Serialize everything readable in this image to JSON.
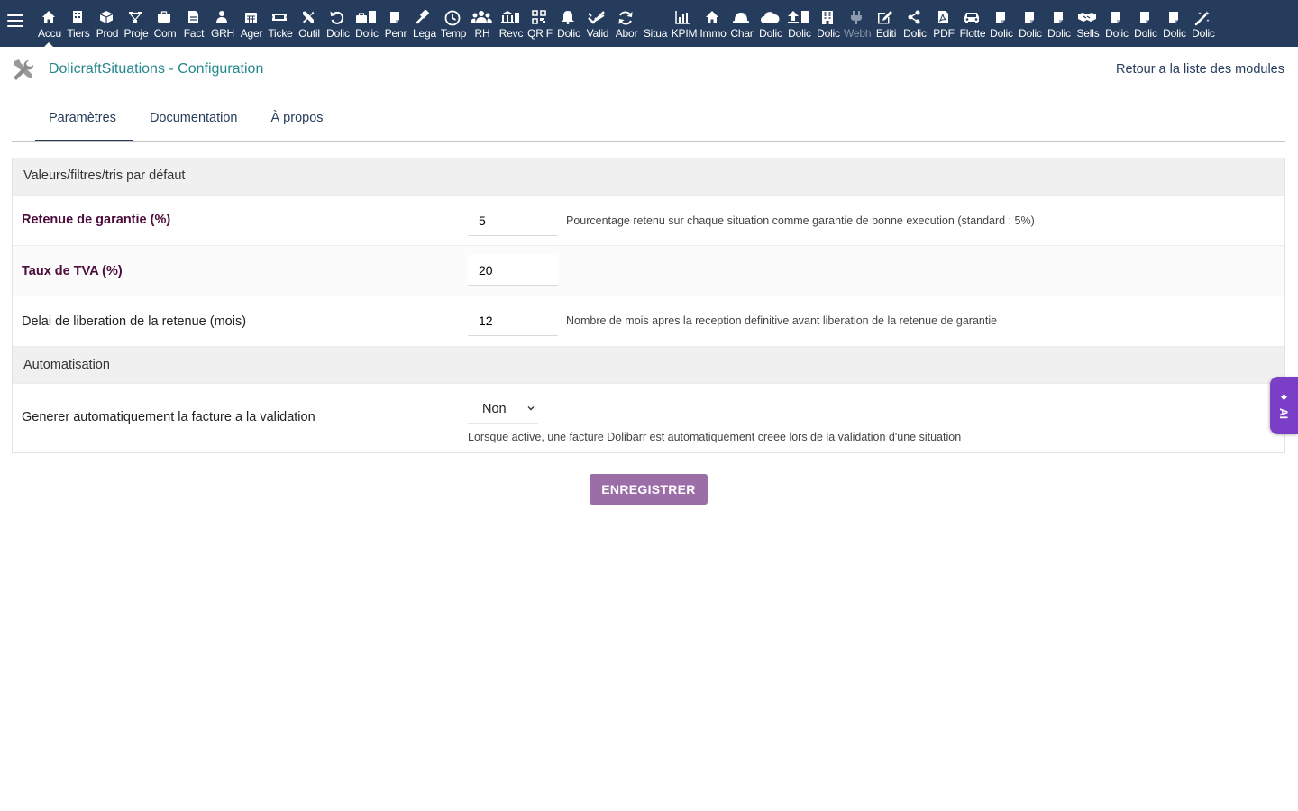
{
  "topbar": {
    "items": [
      {
        "label": "Accu",
        "icon": "home-icon",
        "glyph": "home"
      },
      {
        "label": "Tiers",
        "icon": "building-icon",
        "glyph": "bldg"
      },
      {
        "label": "Prod",
        "icon": "cube-icon",
        "glyph": "cube"
      },
      {
        "label": "Proje",
        "icon": "project-icon",
        "glyph": "proj"
      },
      {
        "label": "Com",
        "icon": "suitcase-icon",
        "glyph": "case"
      },
      {
        "label": "Fact",
        "icon": "invoice-icon",
        "glyph": "doc"
      },
      {
        "label": "GRH",
        "icon": "users-icon",
        "glyph": "grh"
      },
      {
        "label": "Ager",
        "icon": "calendar-icon",
        "glyph": "cal"
      },
      {
        "label": "Ticke",
        "icon": "ticket-icon",
        "glyph": "ticket"
      },
      {
        "label": "Outil",
        "icon": "tools-icon",
        "glyph": "tools"
      },
      {
        "label": "Dolic",
        "icon": "undo-icon",
        "glyph": "undo"
      },
      {
        "label": "Dolic",
        "icon": "briefcase-icon",
        "glyph": "brief"
      },
      {
        "label": "Penr",
        "icon": "note-icon",
        "glyph": "note"
      },
      {
        "label": "Lega",
        "icon": "gavel-icon",
        "glyph": "gavel"
      },
      {
        "label": "Temp",
        "icon": "clock-icon",
        "glyph": "clock"
      },
      {
        "label": "RH",
        "icon": "group-icon",
        "glyph": "group"
      },
      {
        "label": "Revc",
        "icon": "bank-icon",
        "glyph": "bank"
      },
      {
        "label": "QR F",
        "icon": "qr-code-icon",
        "glyph": "qr"
      },
      {
        "label": "Dolic",
        "icon": "bell-icon",
        "glyph": "bell"
      },
      {
        "label": "Valid",
        "icon": "double-check-icon",
        "glyph": "check"
      },
      {
        "label": "Abor",
        "icon": "refresh-icon",
        "glyph": "refresh"
      },
      {
        "label": "Situa",
        "icon": "situation-icon",
        "glyph": "blank"
      },
      {
        "label": "KPIM",
        "icon": "bar-chart-icon",
        "glyph": "chart"
      },
      {
        "label": "Immo",
        "icon": "house-icon",
        "glyph": "home"
      },
      {
        "label": "Char",
        "icon": "hard-hat-icon",
        "glyph": "hat"
      },
      {
        "label": "Dolic",
        "icon": "cloud-icon",
        "glyph": "cloud"
      },
      {
        "label": "Dolic",
        "icon": "upload-icon",
        "glyph": "upload"
      },
      {
        "label": "Dolic",
        "icon": "office-building-icon",
        "glyph": "tower"
      },
      {
        "label": "Webh",
        "icon": "plug-icon",
        "glyph": "plug",
        "dim": true
      },
      {
        "label": "Editi",
        "icon": "edit-icon",
        "glyph": "edit"
      },
      {
        "label": "Dolic",
        "icon": "share-icon",
        "glyph": "share"
      },
      {
        "label": "PDF",
        "icon": "pdf-icon",
        "glyph": "pdf"
      },
      {
        "label": "Flotte",
        "icon": "car-icon",
        "glyph": "car"
      },
      {
        "label": "Dolic",
        "icon": "sticky-note-icon",
        "glyph": "note"
      },
      {
        "label": "Dolic",
        "icon": "sticky-note-icon",
        "glyph": "note"
      },
      {
        "label": "Dolic",
        "icon": "sticky-note-icon",
        "glyph": "note"
      },
      {
        "label": "Sells",
        "icon": "handshake-icon",
        "glyph": "hand"
      },
      {
        "label": "Dolic",
        "icon": "sticky-note-icon",
        "glyph": "note"
      },
      {
        "label": "Dolic",
        "icon": "sticky-note-icon",
        "glyph": "note"
      },
      {
        "label": "Dolic",
        "icon": "sticky-note-icon",
        "glyph": "note"
      },
      {
        "label": "Dolic",
        "icon": "magic-wand-icon",
        "glyph": "wand"
      }
    ]
  },
  "header": {
    "title": "DolicraftSituations - Configuration",
    "back_link": "Retour a la liste des modules"
  },
  "tabs": [
    {
      "label": "Paramètres",
      "active": true
    },
    {
      "label": "Documentation"
    },
    {
      "label": "À propos"
    }
  ],
  "config": {
    "section1": "Valeurs/filtres/tris par défaut",
    "retenue": {
      "label": "Retenue de garantie (%)",
      "value": "5",
      "help": "Pourcentage retenu sur chaque situation comme garantie de bonne execution (standard : 5%)"
    },
    "tva": {
      "label": "Taux de TVA (%)",
      "value": "20"
    },
    "delai": {
      "label": "Delai de liberation de la retenue (mois)",
      "value": "12",
      "help": "Nombre de mois apres la reception definitive avant liberation de la retenue de garantie"
    },
    "section2": "Automatisation",
    "auto": {
      "label": "Generer automatiquement la facture a la validation",
      "value": "Non",
      "help": "Lorsque active, une facture Dolibarr est automatiquement creee lors de la validation d'une situation"
    }
  },
  "save_label": "ENREGISTRER",
  "ai_tab": {
    "label": "AI",
    "icon": "diamond-icon"
  },
  "colors": {
    "topbar": "#263c5c",
    "title": "#26888d",
    "required_label": "#4b0c3b",
    "save_button": "#9b6ea8",
    "ai_tab": "#7b3fc7"
  }
}
